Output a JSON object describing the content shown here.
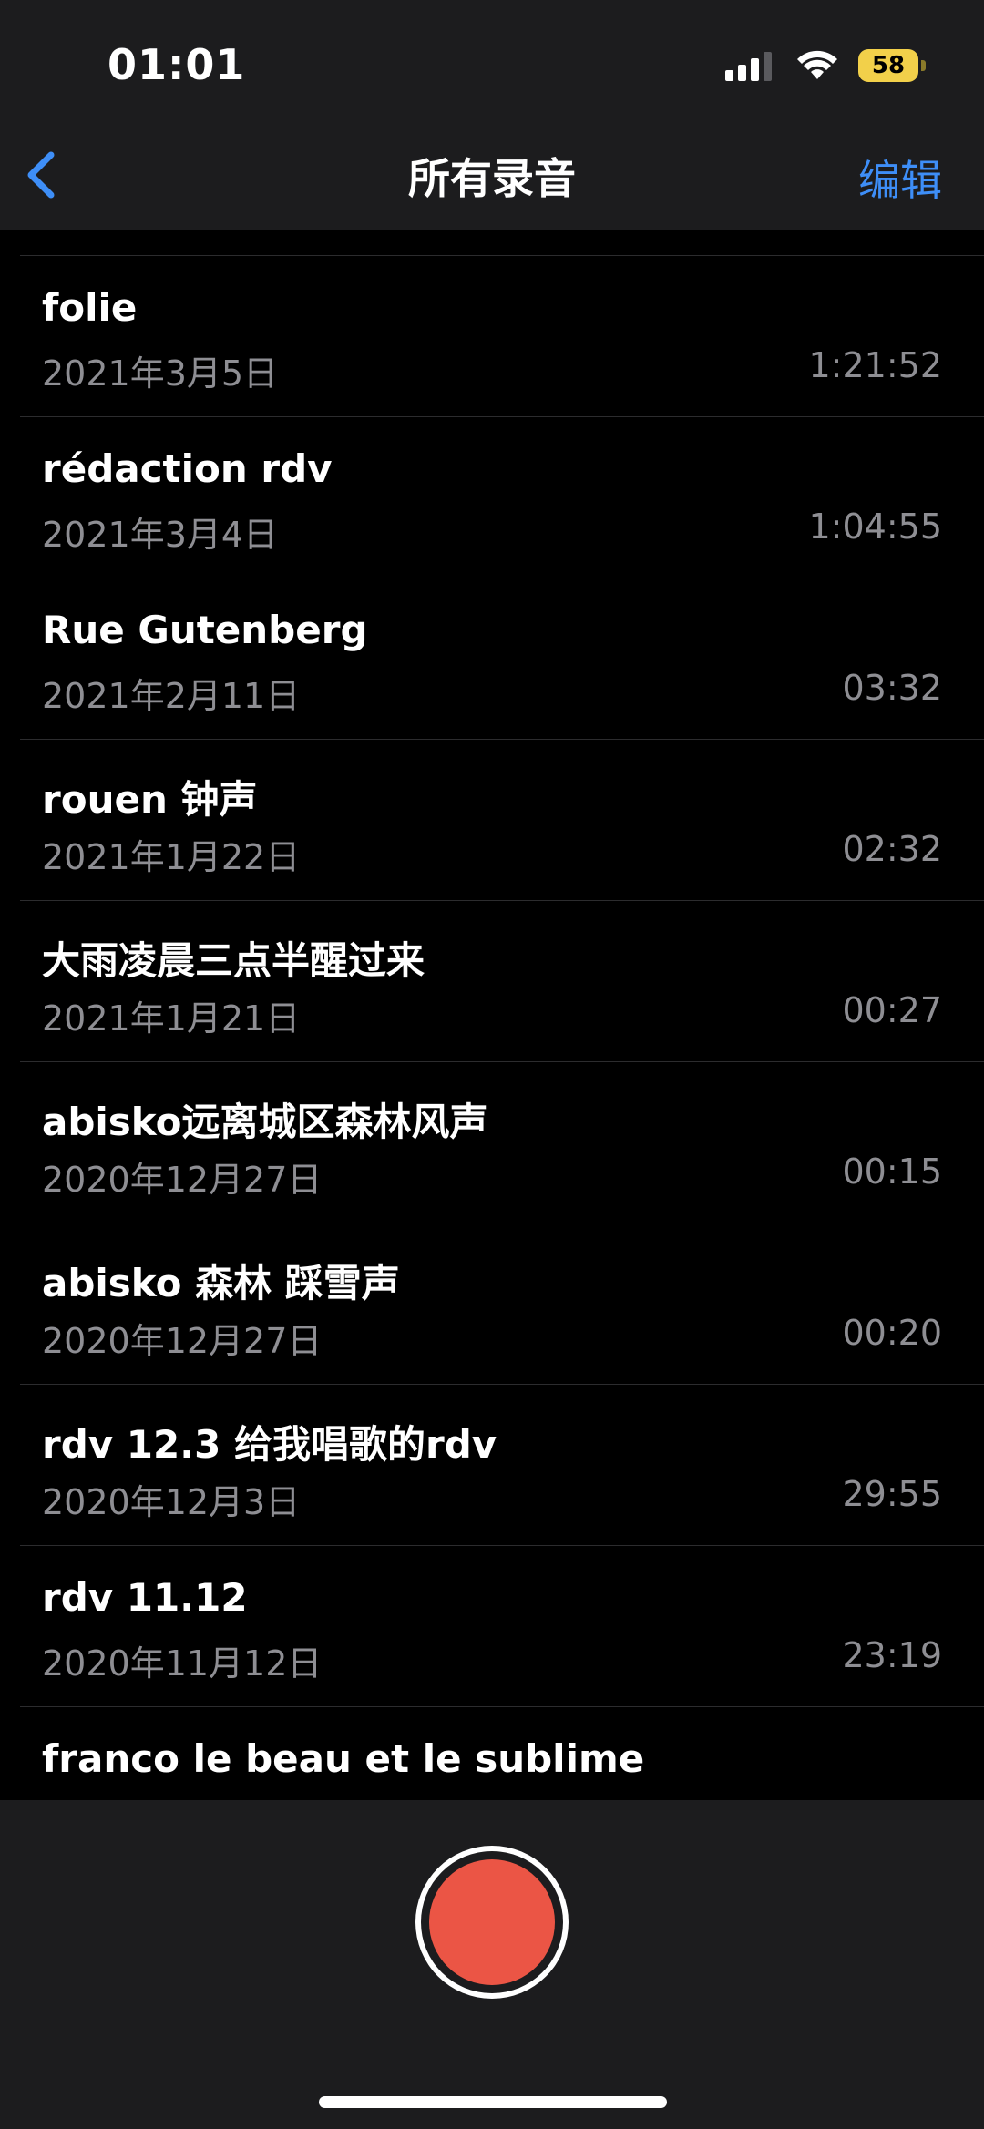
{
  "status_bar": {
    "time": "01:01",
    "battery": "58",
    "signal_icon": "signal-icon",
    "wifi_icon": "wifi-icon",
    "battery_color": "#f2d04a"
  },
  "nav": {
    "back_icon": "chevron-left-icon",
    "title": "所有录音",
    "edit_label": "编辑",
    "accent_color": "#3e8ef7"
  },
  "recordings": [
    {
      "title": "folie",
      "date": "2021年3月5日",
      "duration": "1:21:52"
    },
    {
      "title": "rédaction rdv",
      "date": "2021年3月4日",
      "duration": "1:04:55"
    },
    {
      "title": "Rue Gutenberg",
      "date": "2021年2月11日",
      "duration": "03:32"
    },
    {
      "title": "rouen 钟声",
      "date": "2021年1月22日",
      "duration": "02:32"
    },
    {
      "title": "大雨凌晨三点半醒过来",
      "date": "2021年1月21日",
      "duration": "00:27"
    },
    {
      "title": "abisko远离城区森林风声",
      "date": "2020年12月27日",
      "duration": "00:15"
    },
    {
      "title": "abisko 森林 踩雪声",
      "date": "2020年12月27日",
      "duration": "00:20"
    },
    {
      "title": "rdv 12.3 给我唱歌的rdv",
      "date": "2020年12月3日",
      "duration": "29:55"
    },
    {
      "title": "rdv 11.12",
      "date": "2020年11月12日",
      "duration": "23:19"
    },
    {
      "title": "franco le beau et le sublime",
      "date": "",
      "duration": ""
    }
  ],
  "record_button": {
    "icon": "record-icon",
    "color": "#eb5545"
  }
}
